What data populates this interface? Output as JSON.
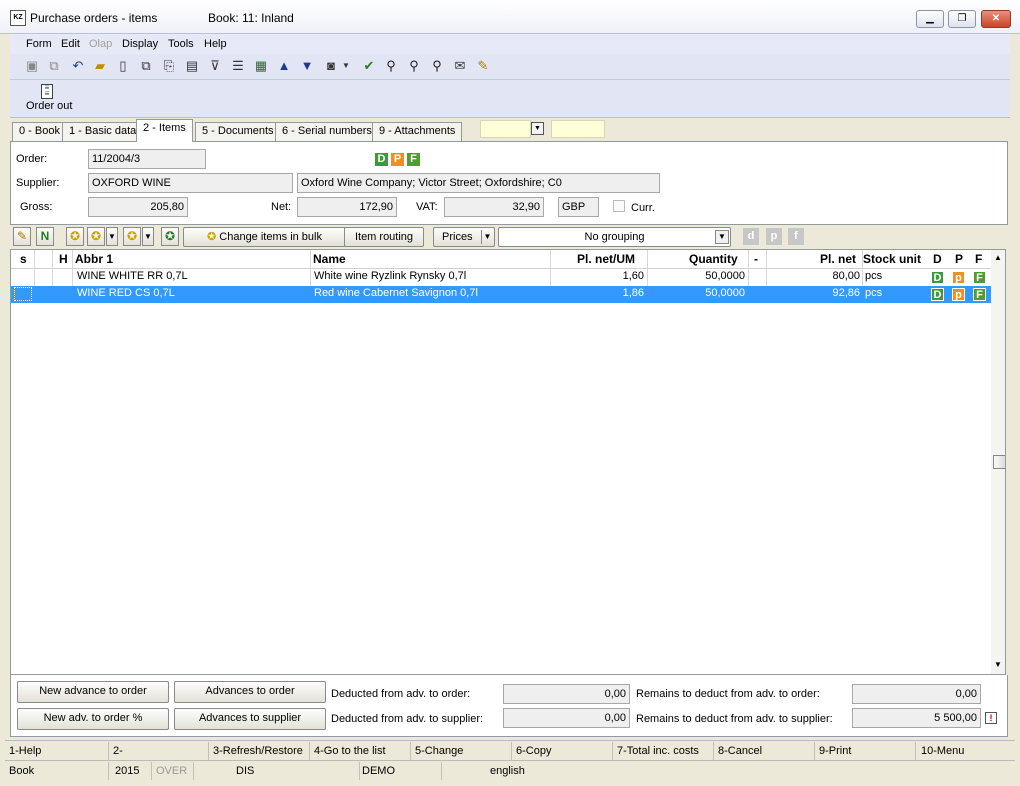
{
  "window": {
    "title": "Purchase orders - items",
    "book": "Book: 11: Inland",
    "app_icon": "KZ"
  },
  "menu": [
    "Form",
    "Edit",
    "Olap",
    "Display",
    "Tools",
    "Help"
  ],
  "toolbar2": {
    "order_out": "Order out"
  },
  "tabs": [
    "0 - Book",
    "1 - Basic data",
    "2 - Items",
    "5 - Documents",
    "6 - Serial numbers",
    "9 - Attachments"
  ],
  "active_tab": "2 - Items",
  "form": {
    "order_label": "Order:",
    "order": "11/2004/3",
    "supplier_label": "Supplier:",
    "supplier": "OXFORD WINE",
    "supplier_address": "Oxford Wine Company; Victor Street; Oxfordshire; C0",
    "gross_label": "Gross:",
    "gross": "205,80",
    "net_label": "Net:",
    "net": "172,90",
    "vat_label": "VAT:",
    "vat": "32,90",
    "currency": "GBP",
    "curr_label": "Curr.",
    "dpf": [
      "D",
      "P",
      "F"
    ]
  },
  "items_toolbar": {
    "change_bulk": "Change items in bulk",
    "item_routing": "Item routing",
    "prices": "Prices",
    "grouping": "No grouping",
    "gray_buttons": [
      "d",
      "p",
      "f"
    ]
  },
  "grid": {
    "columns": {
      "s": "s",
      "h": "H",
      "abbr": "Abbr 1",
      "name": "Name",
      "plnet_um": "Pl. net/UM",
      "quantity": "Quantity",
      "dash": "-",
      "plnet": "Pl. net",
      "stock_unit": "Stock unit",
      "d": "D",
      "p": "P",
      "f": "F"
    },
    "rows": [
      {
        "abbr": "WINE WHITE RR 0,7L",
        "name": "White wine Ryzlink Rynsky 0,7l",
        "plnet_um": "1,60",
        "quantity": "50,0000",
        "plnet": "80,00",
        "unit": "pcs",
        "d": "D",
        "p": "p",
        "f": "F"
      },
      {
        "abbr": "WINE RED CS 0,7L",
        "name": "Red wine Cabernet Savignon 0,7l",
        "plnet_um": "1,86",
        "quantity": "50,0000",
        "plnet": "92,86",
        "unit": "pcs",
        "d": "D",
        "p": "p",
        "f": "F"
      }
    ]
  },
  "bottom": {
    "new_advance": "New advance to order",
    "advances_to_order": "Advances to order",
    "new_adv_pct": "New adv. to order %",
    "advances_to_supplier": "Advances to supplier",
    "deducted_order_label": "Deducted from adv. to order:",
    "deducted_order": "0,00",
    "deducted_supplier_label": "Deducted from adv. to supplier:",
    "deducted_supplier": "0,00",
    "remains_order_label": "Remains to deduct from adv. to order:",
    "remains_order": "0,00",
    "remains_supplier_label": "Remains to deduct from adv. to supplier:",
    "remains_supplier": "5 500,00"
  },
  "fkeys": [
    "1-Help",
    "2-",
    "3-Refresh/Restore",
    "4-Go to the list",
    "5-Change",
    "6-Copy",
    "7-Total inc. costs",
    "8-Cancel",
    "9-Print",
    "10-Menu"
  ],
  "status": {
    "book": "Book",
    "year": "2015",
    "over": "OVER",
    "dis": "DIS",
    "demo": "DEMO",
    "lang": "english"
  },
  "colors": {
    "selection": "#3399ff",
    "d_badge": "#3c9a3c",
    "p_badge": "#f0901c",
    "f_badge": "#4f9d2e"
  }
}
